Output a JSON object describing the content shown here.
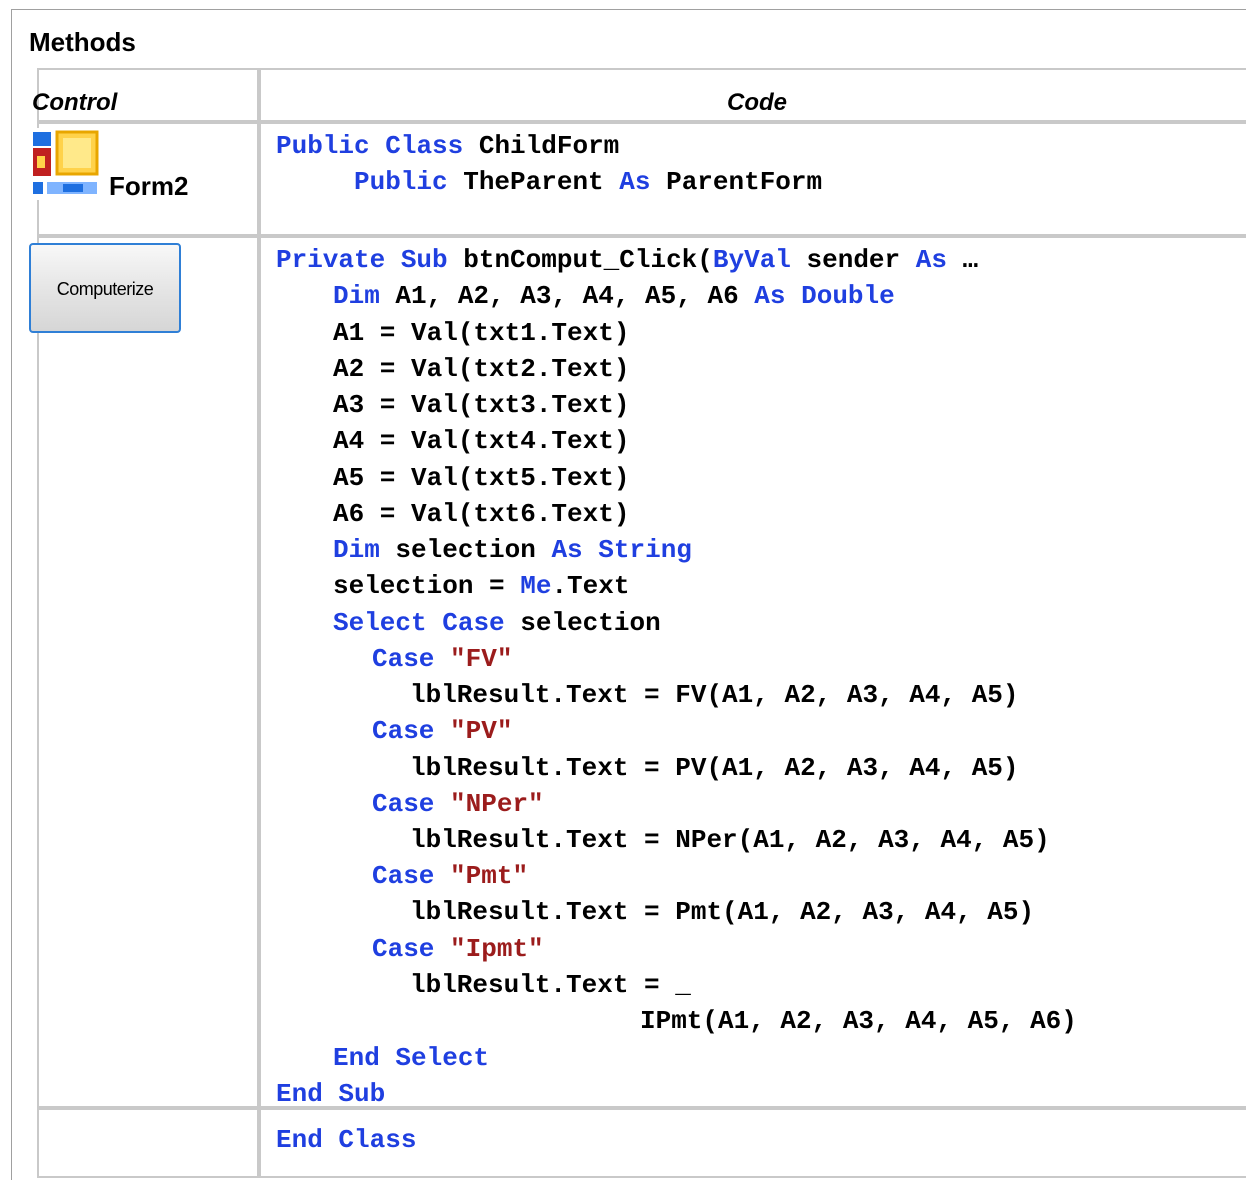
{
  "section_title": "Methods",
  "headers": {
    "control": "Control",
    "code": "Code"
  },
  "row1": {
    "control_label": "Form2",
    "icon": "form-icon"
  },
  "row2": {
    "button_label": "Computerize"
  },
  "code_lines": {
    "l1": [
      "Public",
      " ",
      "Class",
      " ChildForm"
    ],
    "l2": [
      "Public",
      " TheParent ",
      "As",
      " ParentForm"
    ],
    "b1": [
      "Private",
      " ",
      "Sub",
      " btnComput_Click(",
      "ByVal",
      " sender ",
      "As",
      " …"
    ],
    "b2": [
      "Dim",
      " A1, A2, A3, A4, A5, A6 ",
      "As",
      " ",
      "Double"
    ],
    "b3": "A1 = Val(txt1.Text)",
    "b4": "A2 = Val(txt2.Text)",
    "b5": "A3 = Val(txt3.Text)",
    "b6": "A4 = Val(txt4.Text)",
    "b7": "A5 = Val(txt5.Text)",
    "b8": "A6 = Val(txt6.Text)",
    "b9": [
      "Dim",
      " selection ",
      "As",
      " ",
      "String"
    ],
    "b10": [
      "selection = ",
      "Me",
      ".Text"
    ],
    "b11": [
      "Select",
      " ",
      "Case",
      " selection"
    ],
    "c1": [
      "Case",
      " ",
      "\"FV\""
    ],
    "c1r": "lblResult.Text = FV(A1, A2, A3, A4, A5)",
    "c2": [
      "Case",
      " ",
      "\"PV\""
    ],
    "c2r": "lblResult.Text = PV(A1, A2, A3, A4, A5)",
    "c3": [
      "Case",
      " ",
      "\"NPer\""
    ],
    "c3r": "lblResult.Text = NPer(A1, A2, A3, A4, A5)",
    "c4": [
      "Case",
      " ",
      "\"Pmt\""
    ],
    "c4r": "lblResult.Text = Pmt(A1, A2, A3, A4, A5)",
    "c5": [
      "Case",
      " ",
      "\"Ipmt\""
    ],
    "c5r1": "lblResult.Text = _",
    "c5r2": "IPmt(A1, A2, A3, A4, A5, A6)",
    "e1": [
      "End",
      " ",
      "Select"
    ],
    "e2": [
      "End",
      " ",
      "Sub"
    ],
    "e3": [
      "End",
      " ",
      "Class"
    ]
  },
  "colors": {
    "keyword": "#1f3fe0",
    "string": "#9b1c1c",
    "border": "#c9c9c9"
  }
}
